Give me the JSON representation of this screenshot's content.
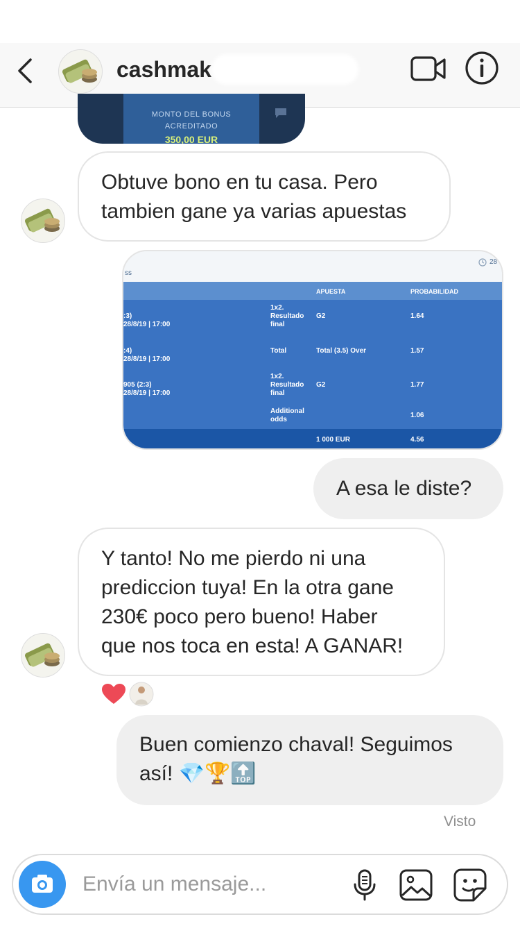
{
  "header": {
    "username": "cashmak",
    "back_icon": "chevron-left-icon",
    "video_icon": "video-camera-icon",
    "info_icon": "info-icon"
  },
  "top_image": {
    "label_line1": "MONTO DEL BONUS",
    "label_line2": "ACREDITADO",
    "amount": "350,00 EUR"
  },
  "messages": {
    "m1": {
      "line1": "Obtuve bono en tu casa. Pero",
      "line2": "tambien gane ya varias apuestas"
    },
    "m2": {
      "text": "A esa le diste?"
    },
    "m3": {
      "line1": "Y tanto! No me pierdo ni una",
      "line2": "prediccion tuya! En la otra gane",
      "line3": "230€ poco pero bueno! Haber",
      "line4": "que nos toca en esta! A GANAR!"
    },
    "m4": {
      "line1": "Buen comienzo chaval! Seguimos",
      "line2": "así! 💎🏆🔝"
    }
  },
  "bet_table": {
    "top_left": "ss",
    "top_right": "28",
    "col_bet": "APUESTA",
    "col_prob": "PROBABILIDAD",
    "rows": [
      {
        "score": ":3)",
        "date": "28/8/19 | 17:00",
        "market1": "1x2.",
        "market2": "Resultado",
        "market3": "final",
        "bet": "G2",
        "prob": "1.64"
      },
      {
        "score": ":4)",
        "date": "28/8/19 | 17:00",
        "market1": "Total",
        "bet": "Total (3.5) Over",
        "prob": "1.57"
      },
      {
        "score": "905 (2:3)",
        "date": "28/8/19 | 17:00",
        "market1": "1x2.",
        "market2": "Resultado",
        "market3": "final",
        "bet": "G2",
        "prob": "1.77"
      },
      {
        "market1": "Additional",
        "market2": "odds",
        "prob": "1.06"
      }
    ],
    "total_stake": "1 000 EUR",
    "total_odds": "4.56"
  },
  "reactions": [
    "red-heart-icon",
    "reactor-avatar"
  ],
  "status": {
    "seen": "Visto"
  },
  "composer": {
    "placeholder": "Envía un mensaje...",
    "camera_icon": "camera-icon",
    "mic_icon": "microphone-icon",
    "gallery_icon": "image-gallery-icon",
    "sticker_icon": "sticker-icon"
  },
  "colors": {
    "accent": "#3897f0",
    "sent_bubble": "#efefef",
    "heart": "#ed4956",
    "table_blue": "#3a73c2"
  }
}
